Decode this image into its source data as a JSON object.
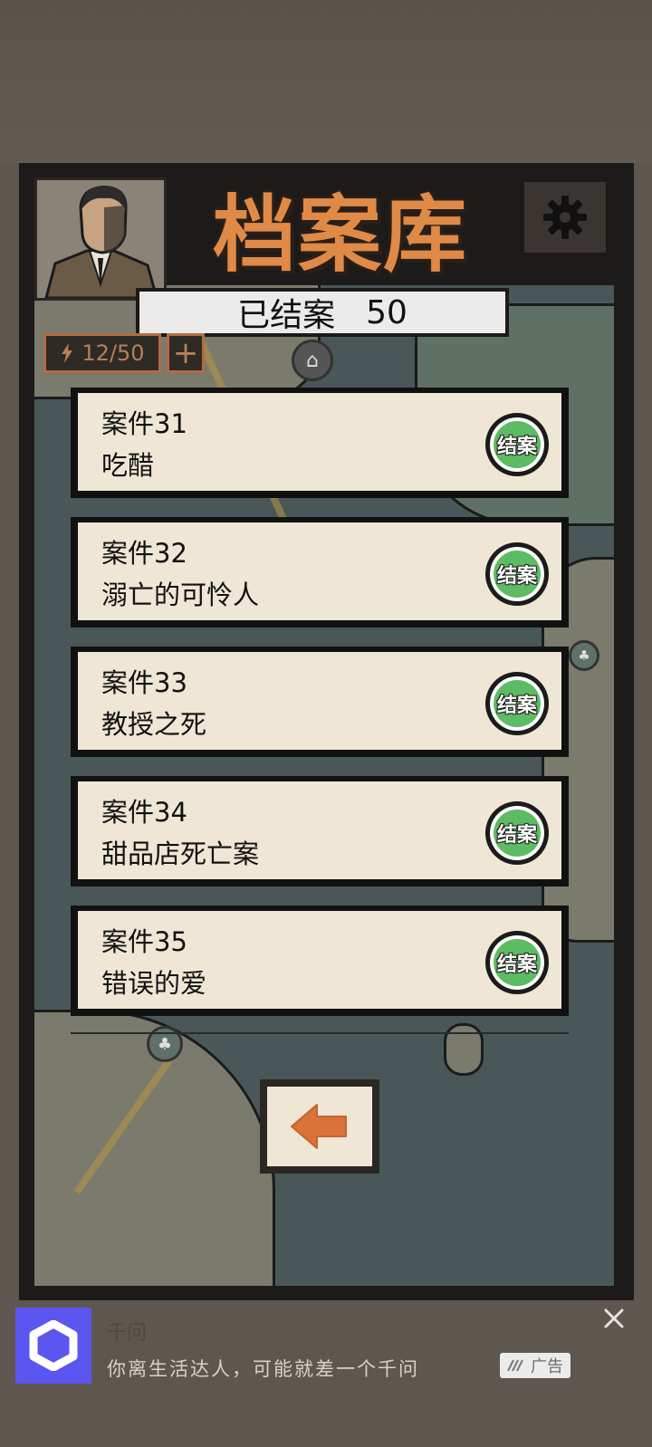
{
  "header": {
    "title": "档案库",
    "closed_label": "已结案",
    "closed_count": "50",
    "energy": "12/50",
    "plus": "+"
  },
  "cases": [
    {
      "number": "案件31",
      "name": "吃醋",
      "stamp": "结案"
    },
    {
      "number": "案件32",
      "name": "溺亡的可怜人",
      "stamp": "结案"
    },
    {
      "number": "案件33",
      "name": "教授之死",
      "stamp": "结案"
    },
    {
      "number": "案件34",
      "name": "甜品店死亡案",
      "stamp": "结案"
    },
    {
      "number": "案件35",
      "name": "错误的爱",
      "stamp": "结案"
    }
  ],
  "ad": {
    "app_name": "千问",
    "text": "你离生活达人，可能就差一个千问",
    "badge": "广告"
  },
  "colors": {
    "title": "#e08a47",
    "stamp_green": "#5dbb63",
    "card": "#efe6d5",
    "back_arrow": "#d9733a",
    "ad_logo": "#5b56f0"
  },
  "icons": [
    "detective-portrait",
    "gear-icon",
    "lightning-icon",
    "factory-icon",
    "tree-icon",
    "back-arrow-icon",
    "close-icon"
  ]
}
